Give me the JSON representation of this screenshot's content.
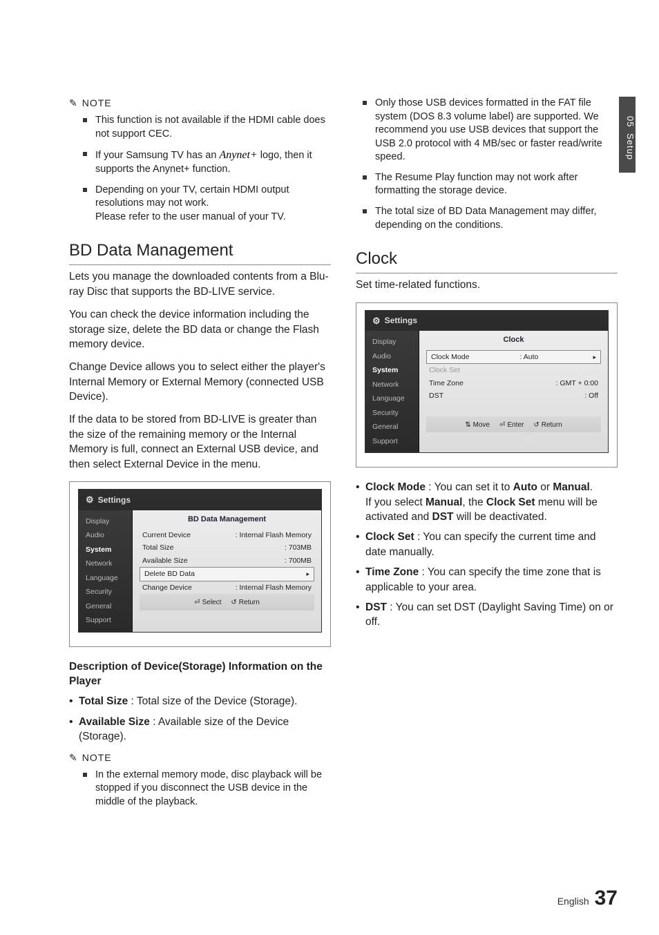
{
  "sideTab": {
    "num": "05",
    "label": "Setup"
  },
  "left": {
    "noteLabel": "NOTE",
    "notes1": [
      "This function is not available if the HDMI cable does not support CEC.",
      "If your Samsung TV has an  Anynet+  logo, then it supports the Anynet+ function.",
      "Depending on your TV, certain HDMI output resolutions may not work.\nPlease refer to the user manual of your TV."
    ],
    "h2": "BD Data Management",
    "p1": "Lets you manage the downloaded contents from a Blu-ray Disc that supports the BD-LIVE service.",
    "p2": "You can check the device information including the storage size, delete the BD data or change the Flash memory device.",
    "p3": "Change Device allows you to select either the player's Internal Memory or External Memory (connected USB Device).",
    "p4": "If the data to be stored from BD-LIVE is greater than the size of the remaining memory or the Internal Memory is full, connect an External USB device, and then select External Device in the menu.",
    "ss1": {
      "title": "Settings",
      "nav": [
        "Display",
        "Audio",
        "System",
        "Network",
        "Language",
        "Security",
        "General",
        "Support"
      ],
      "mainTitle": "BD Data Management",
      "rows": [
        {
          "k": "Current Device",
          "v": ": Internal Flash Memory"
        },
        {
          "k": "Total Size",
          "v": ": 703MB"
        },
        {
          "k": "Available Size",
          "v": ": 700MB"
        },
        {
          "k": "Delete BD Data",
          "v": "",
          "boxed": true,
          "arrow": true
        },
        {
          "k": "Change Device",
          "v": ": Internal Flash Memory"
        }
      ],
      "footer": {
        "select": "Select",
        "ret": "Return"
      }
    },
    "subhead": "Description of Device(Storage) Information on the Player",
    "bullets1": [
      {
        "b": "Total Size",
        "t": " : Total size of the Device (Storage)."
      },
      {
        "b": "Available Size",
        "t": " : Available size of the Device (Storage)."
      }
    ],
    "noteLabel2": "NOTE",
    "notes2": [
      "In the external memory mode, disc playback will be stopped if you disconnect the USB device in the middle of the playback."
    ]
  },
  "right": {
    "notesTop": [
      "Only those USB devices formatted in the FAT file system (DOS 8.3 volume label) are supported. We recommend you use USB devices that support the USB 2.0 protocol with 4 MB/sec or faster read/write speed.",
      "The Resume Play function may not work after formatting the storage device.",
      "The total size of BD Data Management may differ, depending on the conditions."
    ],
    "h2": "Clock",
    "p1": "Set time-related functions.",
    "ss2": {
      "title": "Settings",
      "nav": [
        "Display",
        "Audio",
        "System",
        "Network",
        "Language",
        "Security",
        "General",
        "Support"
      ],
      "mainTitle": "Clock",
      "rows": [
        {
          "k": "Clock Mode",
          "v": ": Auto",
          "boxed": true,
          "arrow": true
        },
        {
          "k": "Clock Set",
          "v": "",
          "dim": true
        },
        {
          "k": "Time Zone",
          "v": ": GMT + 0:00"
        },
        {
          "k": "DST",
          "v": ": Off"
        }
      ],
      "footer": {
        "move": "Move",
        "enter": "Enter",
        "ret": "Return"
      }
    },
    "bullets2": [
      {
        "b": "Clock Mode",
        "t": " : You can set it to ",
        "b2": "Auto",
        "t2": " or ",
        "b3": "Manual",
        "t3": ".",
        "extra": "If you select Manual, the Clock Set menu will be activated and DST will be deactivated.",
        "extraBolds": [
          "Manual",
          "Clock Set",
          "DST"
        ]
      },
      {
        "b": "Clock Set",
        "t": " : You can specify the current time and date manually."
      },
      {
        "b": "Time Zone",
        "t": " : You can specify the time zone that is applicable to your area."
      },
      {
        "b": "DST",
        "t": " : You can set DST (Daylight Saving Time) on or off."
      }
    ]
  },
  "footer": {
    "lang": "English",
    "page": "37"
  }
}
